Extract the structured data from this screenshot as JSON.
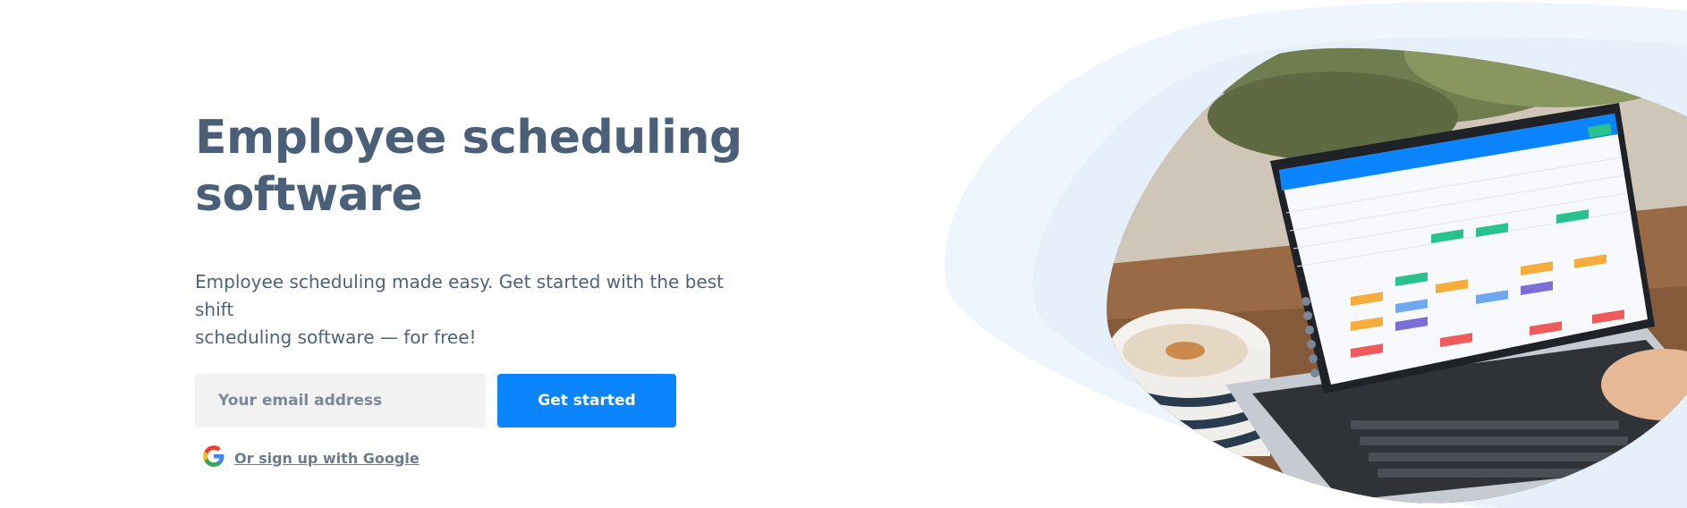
{
  "hero": {
    "title": "Employee scheduling\nsoftware",
    "subtitle": "Employee scheduling made easy. Get started with the best shift\nscheduling software — for free!",
    "email_placeholder": "Your email address",
    "cta_label": "Get started",
    "google_link": "Or sign up with Google"
  },
  "illustration": {
    "description_icon": "laptop-scheduling-app-icon",
    "accent_color": "#0a84ff",
    "background_blob_color": "#eef5fd"
  }
}
